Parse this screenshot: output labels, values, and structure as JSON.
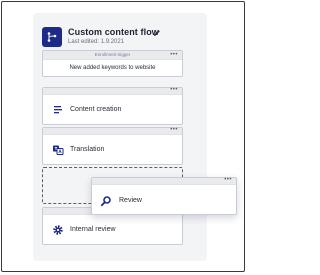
{
  "flow": {
    "title": "Custom content flow",
    "subtitle": "Last edited: 1.9.2021"
  },
  "trigger": {
    "header": "Enrollment trigger",
    "text": "New added keywords to website"
  },
  "steps": [
    {
      "label": "Content creation",
      "icon": "list-lines-icon"
    },
    {
      "label": "Translation",
      "icon": "translate-icon"
    },
    {
      "label": "Internal review",
      "icon": "gear-icon"
    }
  ],
  "dragged_step": {
    "label": "Review",
    "icon": "search-icon"
  },
  "menu_glyph": "•••",
  "colors": {
    "accent": "#1e2a88",
    "panel": "#f3f4f6",
    "card_border": "#c9ccd3"
  }
}
